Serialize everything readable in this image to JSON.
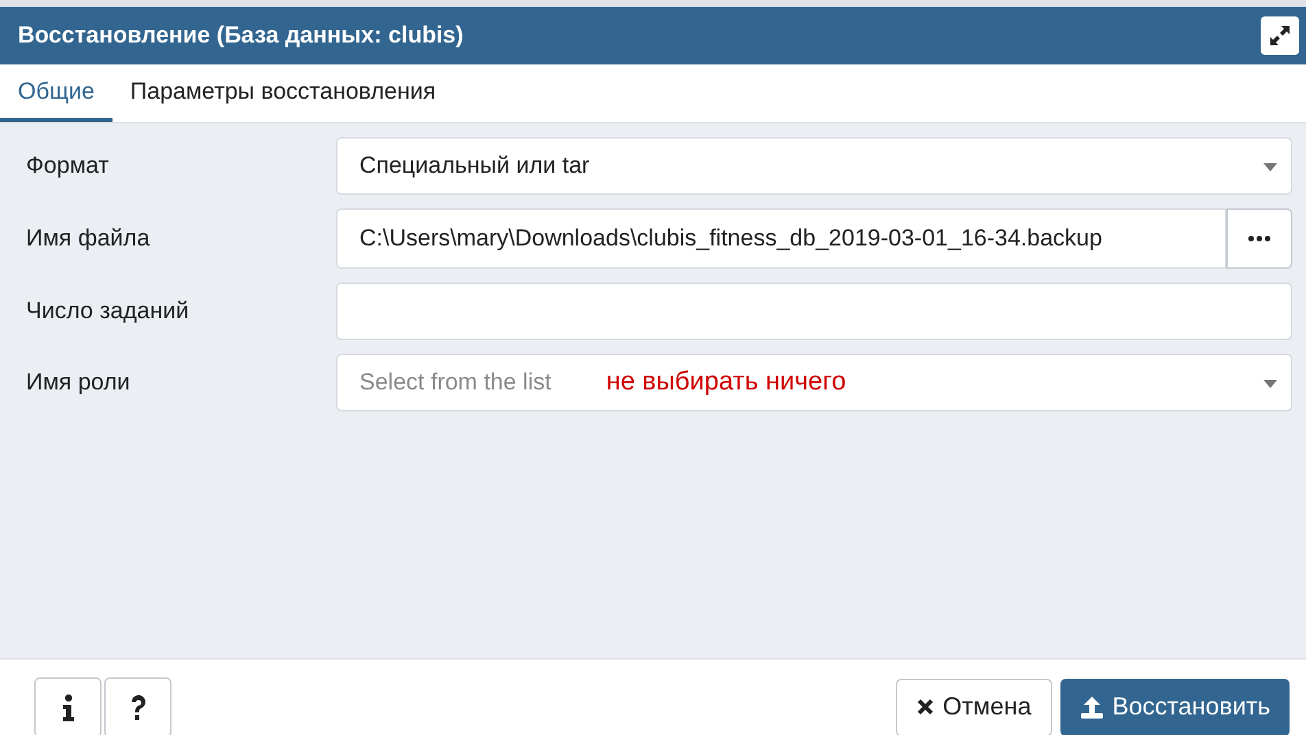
{
  "window": {
    "title": "Восстановление (База данных: clubis)"
  },
  "tabs": [
    {
      "label": "Общие",
      "selected": true
    },
    {
      "label": "Параметры восстановления",
      "selected": false
    }
  ],
  "fields": [
    {
      "kind": "select",
      "label": "Формат",
      "value": "Специальный или tar"
    },
    {
      "kind": "file",
      "label": "Имя файла",
      "value": "C:\\Users\\mary\\Downloads\\clubis_fitness_db_2019-03-01_16-34.backup"
    },
    {
      "kind": "text",
      "label": "Число заданий"
    },
    {
      "kind": "select",
      "label": "Имя роли",
      "placeholder": "Select from the list",
      "annotation": "не выбирать ничего"
    }
  ],
  "footer": {
    "cancel": "Отмена",
    "restore": "Восстановить"
  }
}
